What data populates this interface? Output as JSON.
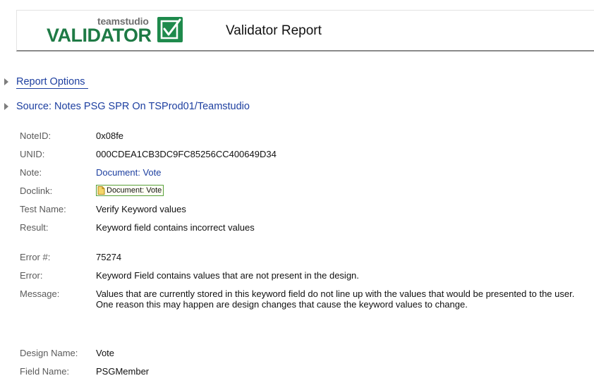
{
  "header": {
    "logo_small": "teamstudio",
    "logo_big": "VALIDATOR",
    "title": "Validator Report"
  },
  "sections": {
    "report_options": "Report Options",
    "source": "Source: Notes PSG SPR On TSProd01/Teamstudio"
  },
  "details": {
    "noteid_label": "NoteID:",
    "noteid_value": "0x08fe",
    "unid_label": "UNID:",
    "unid_value": "000CDEA1CB3DC9FC85256CC400649D34",
    "note_label": "Note:",
    "note_value": "Document: Vote",
    "doclink_label": "Doclink:",
    "doclink_value": "Document: Vote",
    "test_label": "Test Name:",
    "test_value": "Verify Keyword values",
    "result_label": "Result:",
    "result_value": "Keyword field contains incorrect values",
    "error_num_label": "Error #:",
    "error_num_value": "75274",
    "error_label": "Error:",
    "error_value": "Keyword Field contains values that are not present in the design.",
    "message_label": "Message:",
    "message_line1": "Values that are currently stored in this keyword field do not line up with the values that would be presented to the user.",
    "message_line2": "One reason this may happen are design changes that cause the keyword values to change.",
    "design_label": "Design Name:",
    "design_value": "Vote",
    "field_label": "Field Name:",
    "field_value": "PSGMember"
  },
  "colors": {
    "brand_green": "#1e7a45",
    "link_blue": "#1d3fa0"
  },
  "icons": {
    "twisty": "triangle-right",
    "logo_check": "checkmark-box",
    "doclink": "document-icon"
  }
}
